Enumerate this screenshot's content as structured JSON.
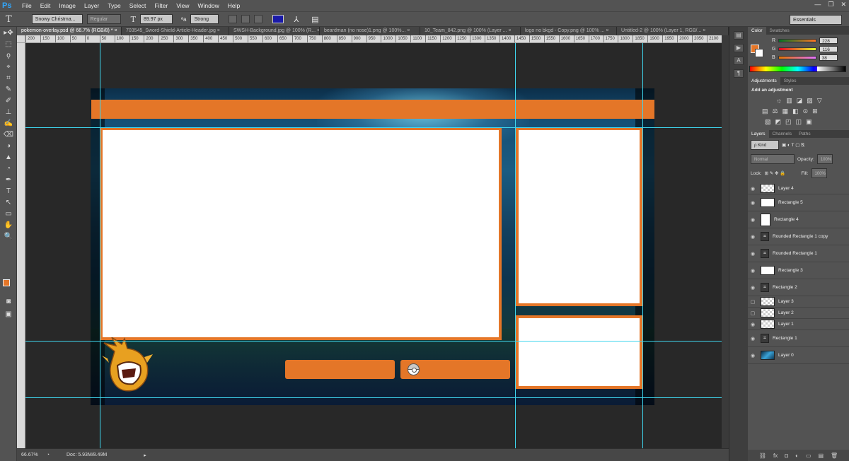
{
  "app": {
    "logo": "Ps"
  },
  "menu": [
    "File",
    "Edit",
    "Image",
    "Layer",
    "Type",
    "Select",
    "Filter",
    "View",
    "Window",
    "Help"
  ],
  "window_controls": [
    "—",
    "❐",
    "✕"
  ],
  "options": {
    "tool_glyph": "T",
    "font_family": "Snowy Christma...",
    "font_style": "Regular",
    "font_size": "89.97 px",
    "aa_icon": "ªa",
    "antialias": "Strong",
    "text_color": "#1a1aa8",
    "workspace": "Essentials"
  },
  "tabs": [
    "pokemon-overlay.psd @ 66.7% (RGB/8) * ×",
    "703545_Sword-Shield-Article-Header.jpg ×",
    "SWSH-Background.jpg @ 100% (R... ×",
    "beardman (no nose)1.png @ 100%... ×",
    "10_Team_842.png @ 100% (Layer ... ×",
    "logo no bkgd - Copy.png @ 100% ... ×",
    "Untitled-2 @ 100% (Layer 1, RGB/... ×"
  ],
  "ruler_ticks": [
    "200",
    "150",
    "100",
    "50",
    "0",
    "50",
    "100",
    "150",
    "200",
    "250",
    "300",
    "350",
    "400",
    "450",
    "500",
    "550",
    "600",
    "650",
    "700",
    "750",
    "800",
    "850",
    "900",
    "950",
    "1000",
    "1050",
    "1100",
    "1150",
    "1200",
    "1250",
    "1300",
    "1350",
    "1400",
    "1450",
    "1500",
    "1550",
    "1600",
    "1650",
    "1700",
    "1750",
    "1800",
    "1850",
    "1900",
    "1950",
    "2000",
    "2050",
    "2100"
  ],
  "tools": [
    "▸✥",
    "⬚",
    "ϙ",
    "⌖",
    "⌗",
    "✎",
    "✐",
    "⊥",
    "✍",
    "⌫",
    "◑",
    "▲",
    "◔",
    "✒",
    "T",
    "↖",
    "▭",
    "✋",
    "🔍"
  ],
  "colors": {
    "foreground": "#e47628",
    "background": "#ffffff",
    "accent_orange": "#e47628",
    "guide": "#3fd6ee"
  },
  "status": {
    "zoom": "66.67%",
    "doc": "Doc: 5.93M/8.49M"
  },
  "color_panel": {
    "tabs": [
      "Color",
      "Swatches"
    ],
    "r_label": "R",
    "g_label": "G",
    "b_label": "B",
    "r": "228",
    "g": "116",
    "b": "38"
  },
  "adjustments": {
    "tabs": [
      "Adjustments",
      "Styles"
    ],
    "title": "Add an adjustment",
    "row1": [
      "☼",
      "▥",
      "◪",
      "▨",
      "▽"
    ],
    "row2": [
      "▤",
      "⚖",
      "▦",
      "◧",
      "⊙",
      "⊞"
    ],
    "row3": [
      "▧",
      "◩",
      "◰",
      "◫",
      "▣"
    ]
  },
  "layers_panel": {
    "tabs": [
      "Layers",
      "Channels",
      "Paths"
    ],
    "kind": "ρ Kind",
    "filter_icons": "▣ ◐ T ▢ ⎘",
    "blend": "Normal",
    "opacity_label": "Opacity:",
    "opacity": "100%",
    "lock_label": "Lock:",
    "lock_icons": "⊞ ✎ ✥ 🔒",
    "fill_label": "Fill:",
    "fill": "100%",
    "footer_icons": [
      "⛓",
      "fx",
      "◘",
      "◐",
      "▭",
      "▤",
      "🗑"
    ],
    "layers": [
      {
        "name": "Layer 4",
        "eye": "◉",
        "thumb": ""
      },
      {
        "name": "Rectangle 5",
        "eye": "◉",
        "thumb": ""
      },
      {
        "name": "Rectangle 4",
        "eye": "◉",
        "thumb": ""
      },
      {
        "name": "Rounded Rectangle 1 copy",
        "eye": "◉",
        "thumb": "⌗"
      },
      {
        "name": "Rounded Rectangle 1",
        "eye": "◉",
        "thumb": "⌗"
      },
      {
        "name": "Rectangle 3",
        "eye": "◉",
        "thumb": ""
      },
      {
        "name": "Rectangle 2",
        "eye": "◉",
        "thumb": "⌗"
      },
      {
        "name": "Layer 3",
        "eye": "▢",
        "thumb": ""
      },
      {
        "name": "Layer 2",
        "eye": "▢",
        "thumb": ""
      },
      {
        "name": "Layer 1",
        "eye": "◉",
        "thumb": ""
      },
      {
        "name": "Rectangle 1",
        "eye": "◉",
        "thumb": "⌗"
      },
      {
        "name": "Layer 0",
        "eye": "◉",
        "thumb": ""
      }
    ]
  }
}
